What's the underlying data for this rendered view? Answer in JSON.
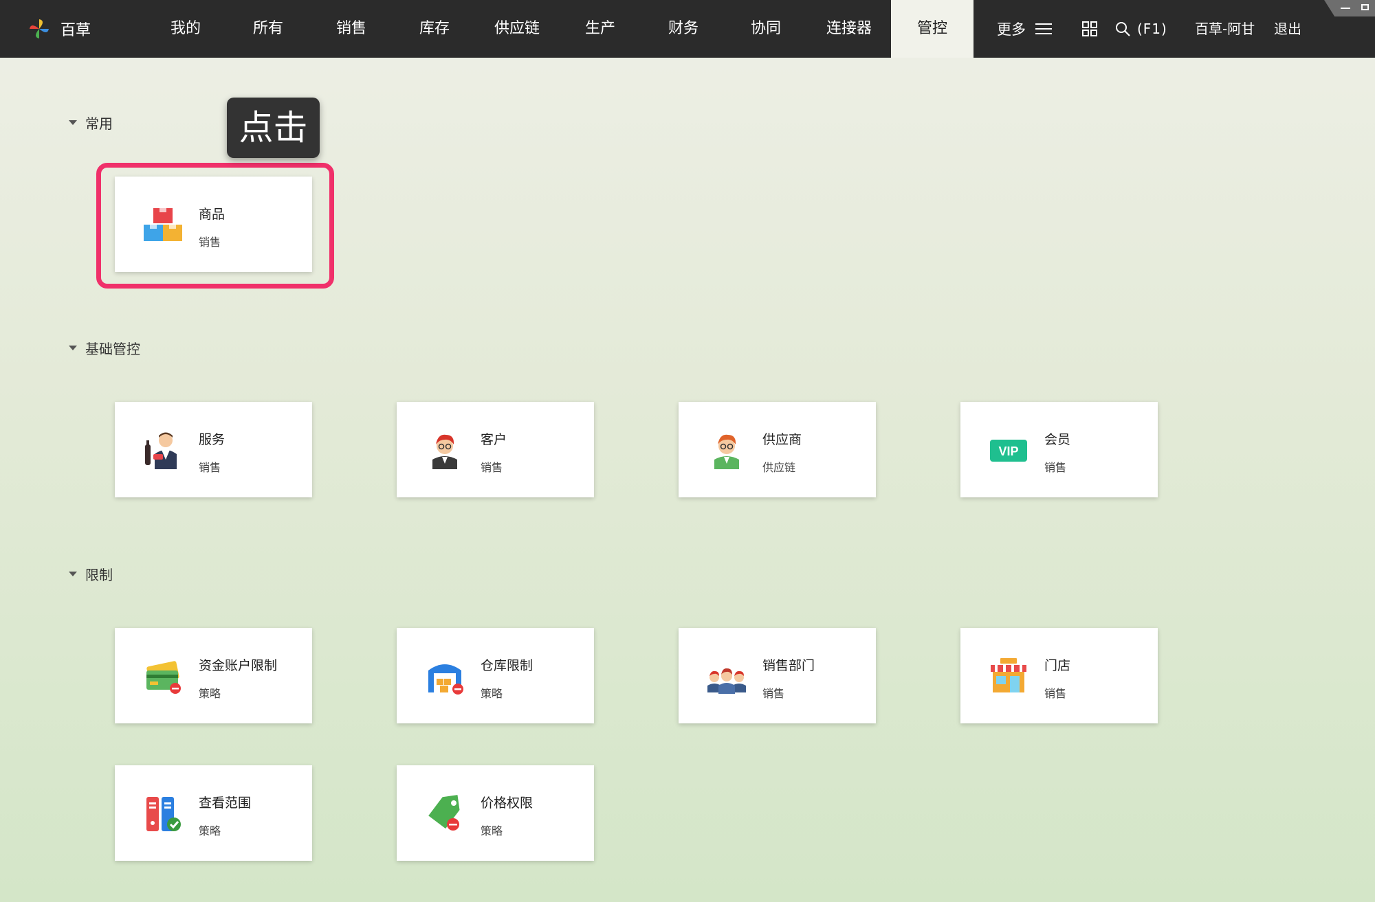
{
  "brand": {
    "name": "百草"
  },
  "nav": {
    "items": [
      "我的",
      "所有",
      "销售",
      "库存",
      "供应链",
      "生产",
      "财务",
      "协同",
      "连接器"
    ],
    "active": "管控",
    "more_label": "更多",
    "search_shortcut": "(F1)",
    "user": "百草-阿甘",
    "logout": "退出"
  },
  "tooltip": {
    "text": "点击"
  },
  "sections": {
    "common": {
      "title": "常用"
    },
    "basic": {
      "title": "基础管控"
    },
    "limits": {
      "title": "限制"
    }
  },
  "cards": {
    "goods": {
      "title": "商品",
      "sub": "销售",
      "icon": "boxes-icon"
    },
    "service": {
      "title": "服务",
      "sub": "销售",
      "icon": "waiter-icon"
    },
    "customer": {
      "title": "客户",
      "sub": "销售",
      "icon": "customer-avatar-icon"
    },
    "supplier": {
      "title": "供应商",
      "sub": "供应链",
      "icon": "supplier-avatar-icon"
    },
    "member": {
      "title": "会员",
      "sub": "销售",
      "icon": "vip-icon",
      "badge": "VIP"
    },
    "fund_account_limit": {
      "title": "资金账户限制",
      "sub": "策略",
      "icon": "card-limit-icon"
    },
    "warehouse_limit": {
      "title": "仓库限制",
      "sub": "策略",
      "icon": "warehouse-limit-icon"
    },
    "sales_dept": {
      "title": "销售部门",
      "sub": "销售",
      "icon": "team-icon"
    },
    "store": {
      "title": "门店",
      "sub": "销售",
      "icon": "shop-icon"
    },
    "view_scope": {
      "title": "查看范围",
      "sub": "策略",
      "icon": "binder-check-icon"
    },
    "price_permission": {
      "title": "价格权限",
      "sub": "策略",
      "icon": "price-tag-icon"
    }
  },
  "colors": {
    "topbar": "#2b2b2b",
    "active_tab": "#f1f2ea",
    "highlight": "#f0306a",
    "vip_green": "#1fbf8f"
  }
}
